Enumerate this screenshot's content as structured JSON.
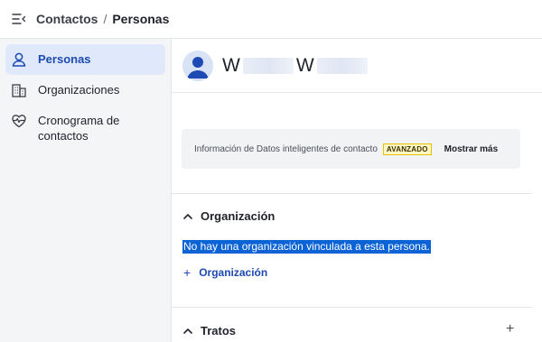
{
  "breadcrumb": {
    "parent": "Contactos",
    "separator": "/",
    "current": "Personas"
  },
  "sidebar": {
    "items": [
      {
        "label": "Personas",
        "icon": "person-icon",
        "active": true
      },
      {
        "label": "Organizaciones",
        "icon": "building-icon",
        "active": false
      },
      {
        "label": "Cronograma de contactos",
        "icon": "heart-pulse-icon",
        "active": false
      }
    ]
  },
  "person": {
    "name_first_initial": "W",
    "name_second_initial": "W"
  },
  "insight": {
    "text": "Información de Datos inteligentes de contacto",
    "badge": "AVANZADO",
    "show_more": "Mostrar más"
  },
  "sections": {
    "organization": {
      "title": "Organización",
      "empty_message": "No hay una organización vinculada a esta persona.",
      "add_label": "Organización"
    },
    "deals": {
      "title": "Tratos"
    }
  },
  "colors": {
    "accent": "#1d4ab3",
    "active_bg": "#dfe9fb",
    "selection": "#0b63d6",
    "badge_border": "#e5c100"
  }
}
